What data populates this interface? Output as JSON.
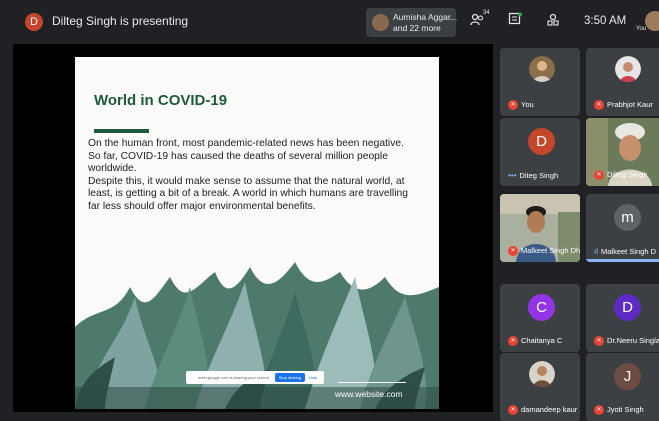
{
  "topbar": {
    "presenter_initial": "D",
    "presenter_text": "Dilteg Singh is presenting",
    "others_name": "Aumisha Aggar...",
    "others_more": "and 22 more",
    "people_count": "34",
    "time": "3:50 AM",
    "self_label": "You"
  },
  "slide": {
    "title": "World in COVID-19",
    "paragraphs": [
      "On the human front, most pandemic-related news has been negative.",
      "So far, COVID-19 has caused the deaths of several million people worldwide.",
      "Despite this, it would make sense to assume that the natural world, at least, is getting a bit of a break. A world in which humans are travelling far less should offer major environmental benefits."
    ],
    "share_banner": "meet.google.com is sharing your screen.",
    "stop_label": "Stop sharing",
    "hide_label": "Hide",
    "website": "www.website.com"
  },
  "participants": [
    {
      "name": "You",
      "muted": true
    },
    {
      "name": "Prabhjot Kaur",
      "muted": true
    },
    {
      "name": "Diteg Singh",
      "initial": "D",
      "color": "#c5462b",
      "speaking": false
    },
    {
      "name": "Dilteg Singh",
      "muted": true
    },
    {
      "name": "Malkeet Singh Dhi...",
      "muted": true
    },
    {
      "name": "Malkeet Singh D",
      "initial": "m",
      "color": "#5f6368",
      "speaking": true
    },
    {
      "name": "Chaitanya C",
      "initial": "C",
      "color": "#9334e6",
      "muted": true
    },
    {
      "name": "Dr.Neeru Singla",
      "initial": "D",
      "color": "#5b2bc4",
      "muted": true
    },
    {
      "name": "damandeep kaur",
      "muted": true
    },
    {
      "name": "Jyoti Singh",
      "initial": "J",
      "color": "#6d4c41",
      "muted": true
    }
  ],
  "colors": {
    "background": "#202124",
    "tile": "#3c4043",
    "slide_accent": "#1e5a3d",
    "mic_off": "#ea4335"
  }
}
